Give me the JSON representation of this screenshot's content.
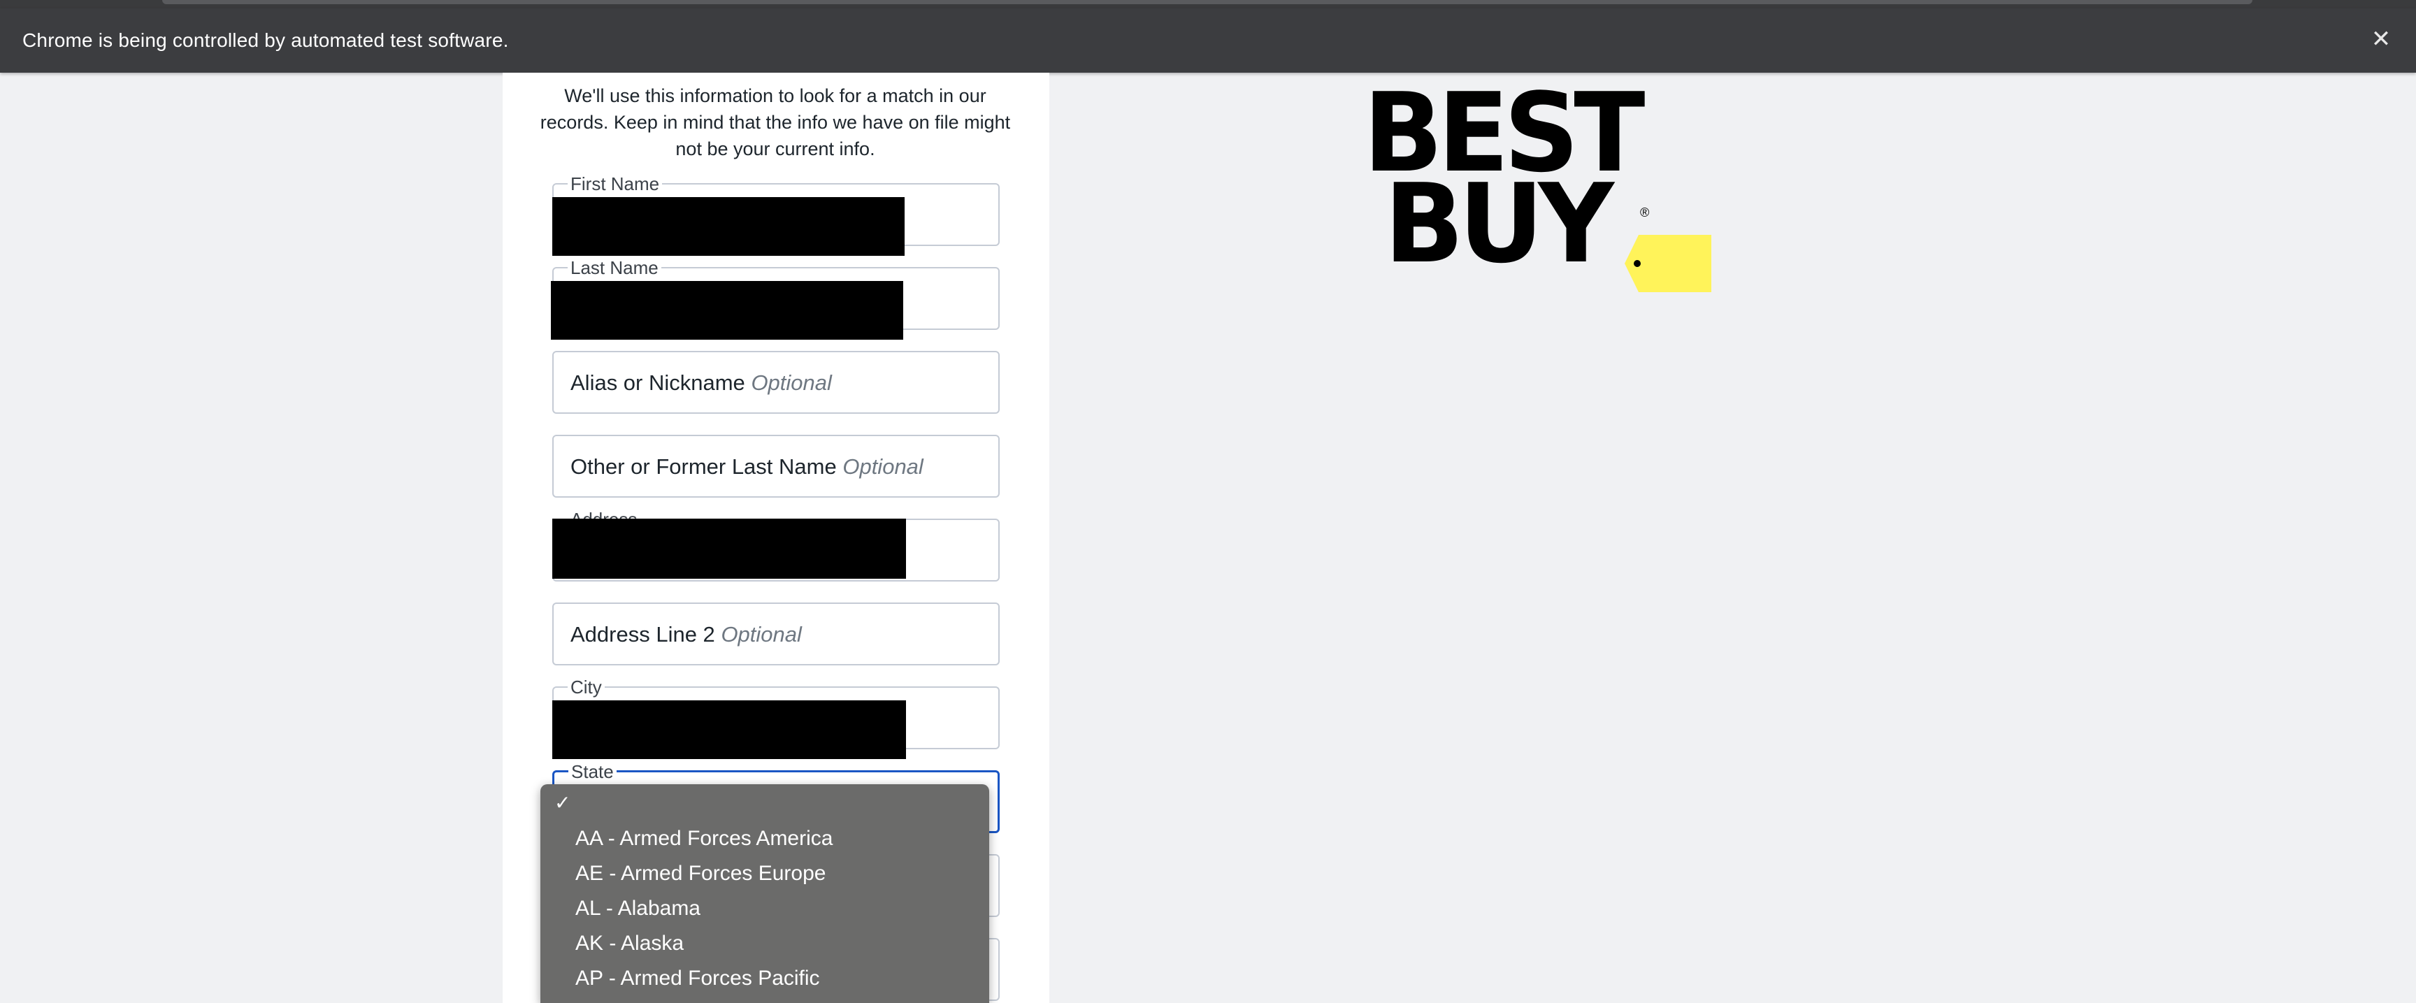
{
  "browser": {
    "infobar_message": "Chrome is being controlled by automated test software.",
    "close_symbol": "✕"
  },
  "form": {
    "intro": "We'll use this information to look for a match in our records. Keep in mind that the info we have on file might not be your current info.",
    "fields": {
      "first_name": {
        "label": "First Name"
      },
      "last_name": {
        "label": "Last Name"
      },
      "alias": {
        "label": "Alias or Nickname",
        "optional": "Optional"
      },
      "former_last_name": {
        "label": "Other or Former Last Name",
        "optional": "Optional"
      },
      "address": {
        "label": "Address"
      },
      "address_line2": {
        "label": "Address Line 2",
        "optional": "Optional"
      },
      "city": {
        "label": "City"
      },
      "state": {
        "label": "State"
      }
    }
  },
  "state_dropdown": {
    "selected_marker": "✓",
    "options": [
      "AA - Armed Forces America",
      "AE - Armed Forces Europe",
      "AL - Alabama",
      "AK - Alaska",
      "AP - Armed Forces Pacific"
    ]
  },
  "logo": {
    "line1": "BEST",
    "line2": "BUY",
    "registered": "®",
    "colors": {
      "text": "#000000",
      "tag": "#fff200"
    }
  },
  "colors": {
    "focus_border": "#1a56c4",
    "dropdown_bg": "#6b6b6a",
    "infobar_bg": "#3c3d40"
  }
}
